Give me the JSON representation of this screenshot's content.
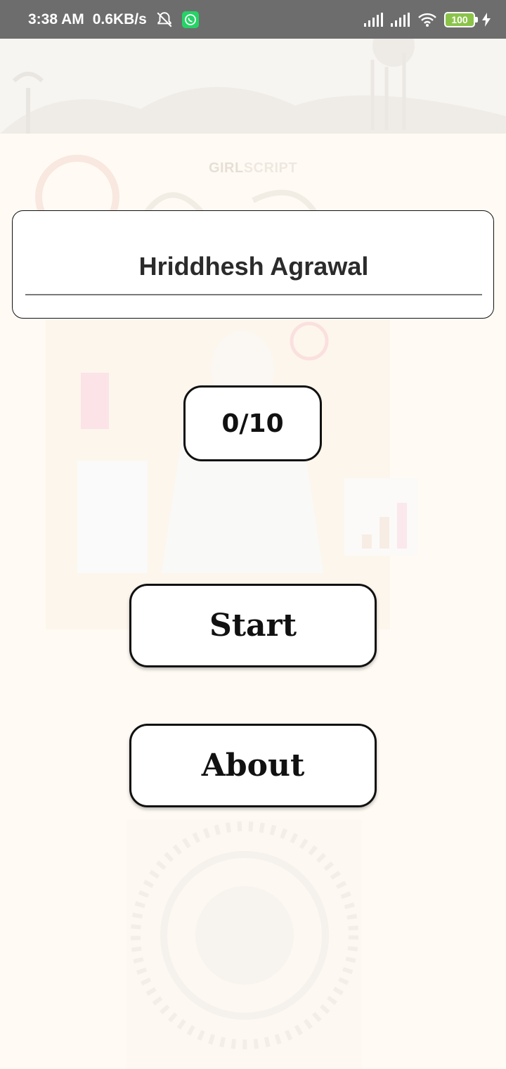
{
  "status_bar": {
    "time": "3:38 AM",
    "speed": "0.6KB/s",
    "battery": "100",
    "icons": [
      "alarm-off-icon",
      "whatsapp-icon",
      "signal-icon",
      "signal-icon",
      "wifi-icon",
      "battery-icon",
      "charging-icon"
    ]
  },
  "background": {
    "brand_part1": "GIRL",
    "brand_part2": "SCRIPT"
  },
  "name_field": {
    "value": "Hriddhesh Agrawal"
  },
  "score": "0/10",
  "buttons": {
    "start": "Start",
    "about": "About"
  },
  "colors": {
    "status_bar": "#6d6d6d",
    "background": "#fffbf4",
    "whatsapp": "#25d366",
    "battery": "#8bc34a"
  }
}
